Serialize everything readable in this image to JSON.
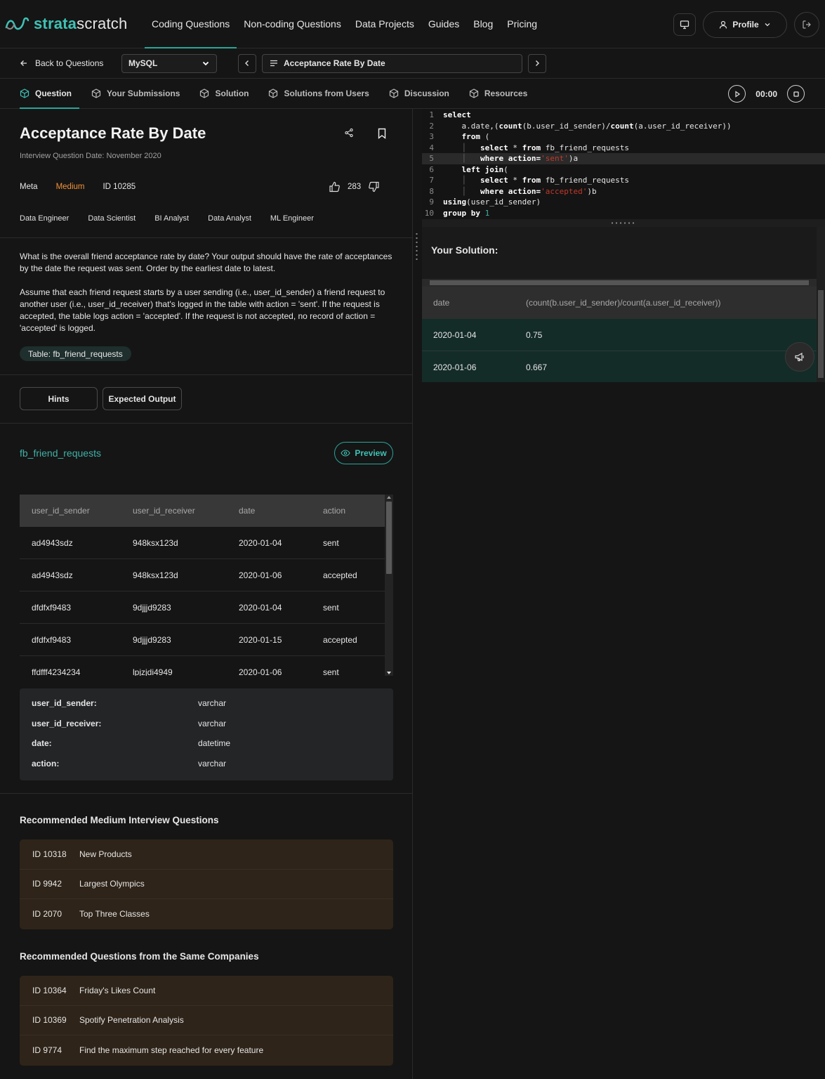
{
  "nav": {
    "logo_a": "strata",
    "logo_b": "scratch",
    "links": [
      "Coding Questions",
      "Non-coding Questions",
      "Data Projects",
      "Guides",
      "Blog",
      "Pricing"
    ],
    "profile": "Profile"
  },
  "subbar": {
    "back": "Back to Questions",
    "language": "MySQL",
    "question": "Acceptance Rate By Date"
  },
  "tabs": [
    "Question",
    "Your Submissions",
    "Solution",
    "Solutions from Users",
    "Discussion",
    "Resources"
  ],
  "timer": "00:00",
  "question": {
    "title": "Acceptance Rate By Date",
    "date": "Interview Question Date: November 2020",
    "company": "Meta",
    "difficulty": "Medium",
    "id": "ID 10285",
    "votes": "283",
    "roles": [
      "Data Engineer",
      "Data Scientist",
      "BI Analyst",
      "Data Analyst",
      "ML Engineer"
    ],
    "desc1": "What is the overall friend acceptance rate by date? Your output should have the rate of acceptances by the date the request was sent. Order by the earliest date to latest.",
    "desc2": "Assume that each friend request starts by a user sending (i.e., user_id_sender) a friend request to another user (i.e., user_id_receiver) that's logged in the table with action = 'sent'. If the request is accepted, the table logs action = 'accepted'. If the request is not accepted, no record of action = 'accepted' is logged.",
    "table_chip": "Table: fb_friend_requests"
  },
  "buttons": {
    "hints": "Hints",
    "expected": "Expected Output",
    "preview": "Preview"
  },
  "table_name": "fb_friend_requests",
  "data_table": {
    "headers": [
      "user_id_sender",
      "user_id_receiver",
      "date",
      "action"
    ],
    "rows": [
      [
        "ad4943sdz",
        "948ksx123d",
        "2020-01-04",
        "sent"
      ],
      [
        "ad4943sdz",
        "948ksx123d",
        "2020-01-06",
        "accepted"
      ],
      [
        "dfdfxf9483",
        "9djjjd9283",
        "2020-01-04",
        "sent"
      ],
      [
        "dfdfxf9483",
        "9djjjd9283",
        "2020-01-15",
        "accepted"
      ],
      [
        "ffdfff4234234",
        "lpjzjdi4949",
        "2020-01-06",
        "sent"
      ]
    ]
  },
  "schema": [
    [
      "user_id_sender:",
      "varchar"
    ],
    [
      "user_id_receiver:",
      "varchar"
    ],
    [
      "date:",
      "datetime"
    ],
    [
      "action:",
      "varchar"
    ]
  ],
  "rec_medium": {
    "title": "Recommended Medium Interview Questions",
    "items": [
      [
        "ID 10318",
        "New Products"
      ],
      [
        "ID 9942",
        "Largest Olympics"
      ],
      [
        "ID 2070",
        "Top Three Classes"
      ]
    ]
  },
  "rec_companies": {
    "title": "Recommended Questions from the Same Companies",
    "items": [
      [
        "ID 10364",
        "Friday's Likes Count"
      ],
      [
        "ID 10369",
        "Spotify Penetration Analysis"
      ],
      [
        "ID 9774",
        "Find the maximum step reached for every feature"
      ]
    ]
  },
  "code": {
    "line_numbers": [
      "1",
      "2",
      "3",
      "4",
      "5",
      "6",
      "7",
      "8",
      "9",
      "10"
    ],
    "l1": "select",
    "l2a": "a.date,(",
    "l2b": "count",
    "l2c": "(b.user_id_sender)/",
    "l2d": "count",
    "l2e": "(a.user_id_receiver))",
    "l3a": "from",
    "l3b": " (",
    "l4a": "select",
    "l4b": " * ",
    "l4c": "from",
    "l4d": " fb_friend_requests",
    "l5a": "where",
    "l5b": " action=",
    "l5c": "'sent'",
    "l5d": ")a",
    "l6a": "left join",
    "l6b": "(",
    "l7a": "select",
    "l7b": " * ",
    "l7c": "from",
    "l7d": " fb_friend_requests",
    "l8a": "where",
    "l8b": " action=",
    "l8c": "'accepted'",
    "l8d": ")b",
    "l9a": "using",
    "l9b": "(user_id_sender)",
    "l10a": "group by",
    "l10b": "1"
  },
  "solution": {
    "title": "Your Solution:",
    "headers": [
      "date",
      "(count(b.user_id_sender)/count(a.user_id_receiver))"
    ],
    "rows": [
      [
        "2020-01-04",
        "0.75"
      ],
      [
        "2020-01-06",
        "0.667"
      ]
    ]
  },
  "colors": {
    "accent": "#2aa59a",
    "medium": "#f0923a",
    "bg": "#151515"
  }
}
